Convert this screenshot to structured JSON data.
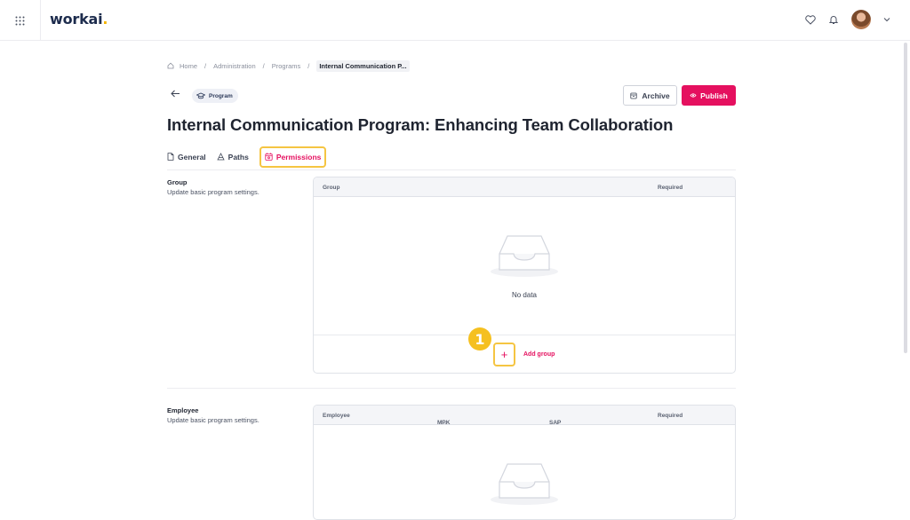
{
  "app": {
    "logo_text": "workai",
    "logo_dot": "."
  },
  "topbar": {
    "icons": [
      "apps-grid-icon",
      "heart-icon",
      "bell-icon",
      "avatar",
      "chevron-down-icon"
    ]
  },
  "breadcrumb": {
    "items": [
      "Home",
      "Administration",
      "Programs"
    ],
    "current": "Internal Communication P...",
    "separator": "/"
  },
  "header": {
    "badge_label": "Program",
    "archive_label": "Archive",
    "publish_label": "Publish"
  },
  "page_title": "Internal Communication Program: Enhancing Team Collaboration",
  "tabs": [
    {
      "label": "General",
      "icon": "document-icon",
      "active": false
    },
    {
      "label": "Paths",
      "icon": "paths-icon",
      "active": false
    },
    {
      "label": "Permissions",
      "icon": "permissions-icon",
      "active": true
    }
  ],
  "group_section": {
    "title": "Group",
    "description": "Update basic program settings.",
    "columns": [
      "Group",
      "Required"
    ],
    "empty_text": "No data",
    "add_label": "Add group",
    "step_number": "1"
  },
  "employee_section": {
    "title": "Employee",
    "description": "Update basic program settings.",
    "columns": [
      "Employee",
      "MPK",
      "SAP",
      "Required"
    ],
    "sort_icon": "↑↓"
  },
  "colors": {
    "accent": "#e5105f",
    "highlight": "#f5c542",
    "brand": "#1d2c4d"
  }
}
